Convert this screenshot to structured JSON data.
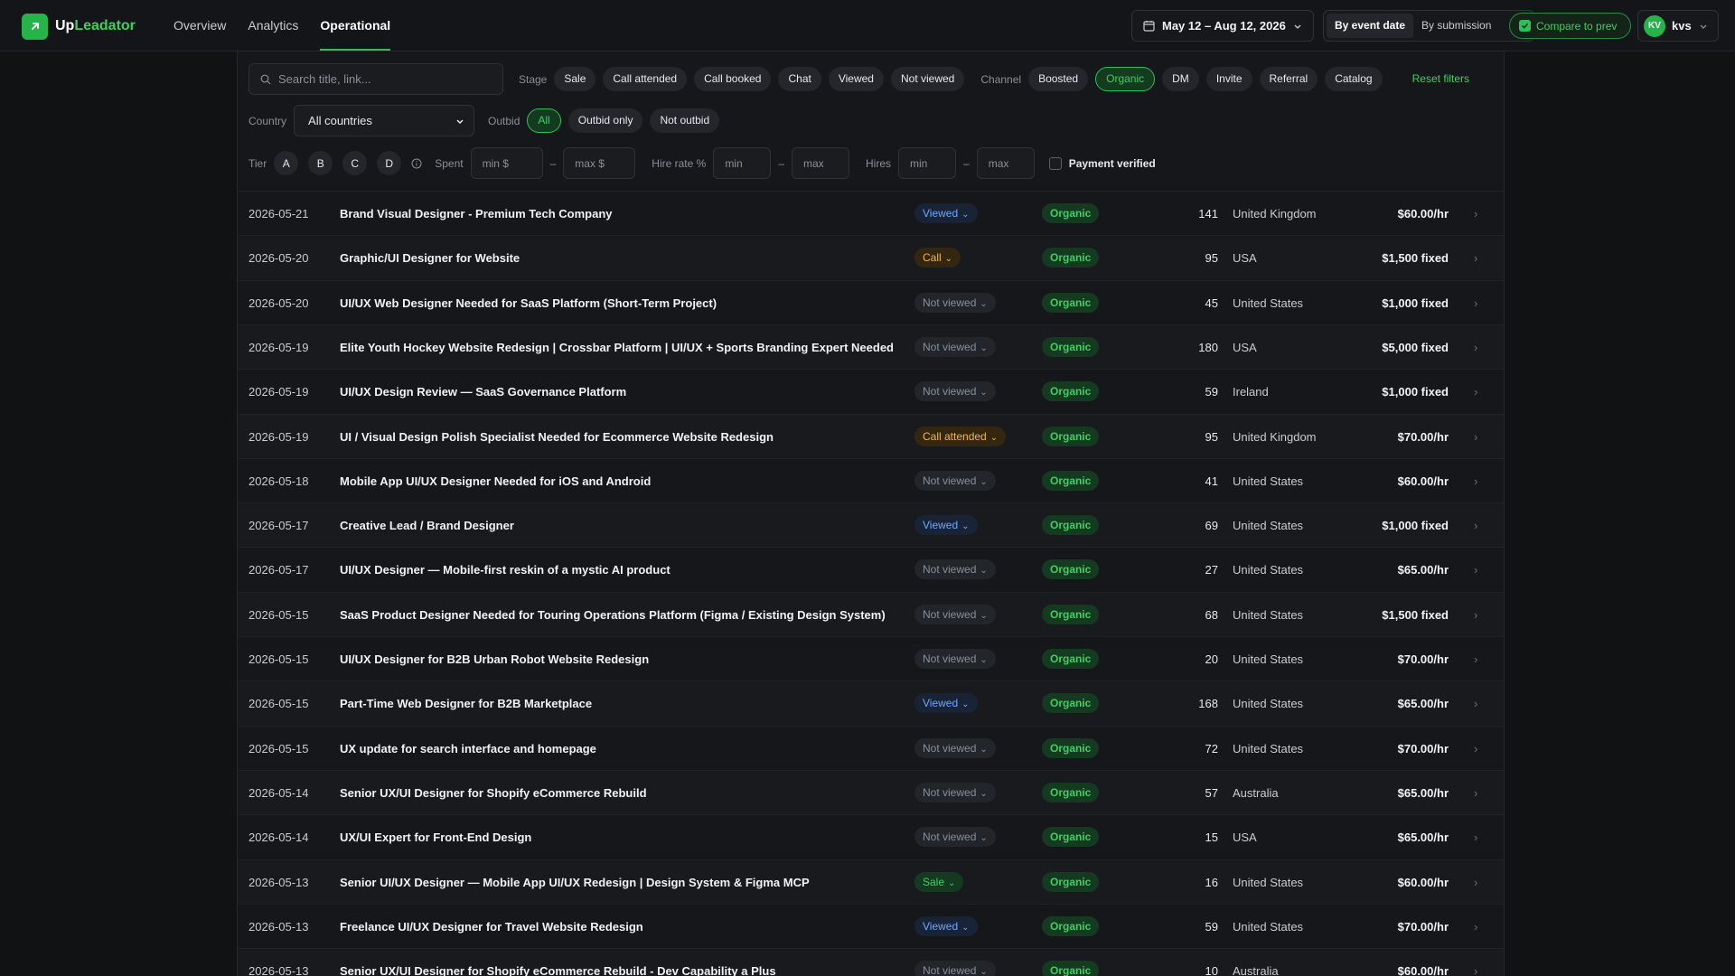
{
  "app": {
    "brand_up": "Up",
    "brand_rest": "Leadator"
  },
  "nav": [
    {
      "label": "Overview",
      "active": false
    },
    {
      "label": "Analytics",
      "active": false
    },
    {
      "label": "Operational",
      "active": true
    }
  ],
  "header": {
    "date_range": "May 12 – Aug 12, 2026",
    "by_event": "By event date",
    "by_submission": "By submission",
    "compare": "Compare to prev",
    "avatar_initials": "KV",
    "user_name": "kvs"
  },
  "filters": {
    "search_placeholder": "Search title, link...",
    "stage_label": "Stage",
    "stages": [
      "Sale",
      "Call attended",
      "Call booked",
      "Chat",
      "Viewed",
      "Not viewed"
    ],
    "channel_label": "Channel",
    "channels": [
      {
        "label": "Boosted",
        "active": false
      },
      {
        "label": "Organic",
        "active": true
      },
      {
        "label": "DM",
        "active": false
      },
      {
        "label": "Invite",
        "active": false
      },
      {
        "label": "Referral",
        "active": false
      },
      {
        "label": "Catalog",
        "active": false
      }
    ],
    "reset": "Reset filters",
    "country_label": "Country",
    "country_value": "All countries",
    "outbid_label": "Outbid",
    "outbid_options": [
      {
        "label": "All",
        "active": true
      },
      {
        "label": "Outbid only",
        "active": false
      },
      {
        "label": "Not outbid",
        "active": false
      }
    ],
    "tier_label": "Tier",
    "tiers": [
      "A",
      "B",
      "C",
      "D"
    ],
    "spent_label": "Spent",
    "spent_min": "min $",
    "spent_max": "max $",
    "hire_rate_label": "Hire rate %",
    "hire_min": "min",
    "hire_max": "max",
    "hires_label": "Hires",
    "hires_min": "min",
    "hires_max": "max",
    "payment_verified": "Payment verified",
    "range_dash": "–"
  },
  "rows": [
    {
      "date": "2026-05-21",
      "title": "Brand Visual Designer - Premium Tech Company",
      "stage": "Viewed",
      "stage_type": "viewed",
      "channel": "Organic",
      "count": "141",
      "country": "United Kingdom",
      "rate": "$60.00/hr"
    },
    {
      "date": "2026-05-20",
      "title": "Graphic/UI Designer for Website",
      "stage": "Call",
      "stage_type": "call",
      "channel": "Organic",
      "count": "95",
      "country": "USA",
      "rate": "$1,500 fixed"
    },
    {
      "date": "2026-05-20",
      "title": "UI/UX Web Designer Needed for SaaS Platform (Short-Term Project)",
      "stage": "Not viewed",
      "stage_type": "not",
      "channel": "Organic",
      "count": "45",
      "country": "United States",
      "rate": "$1,000 fixed"
    },
    {
      "date": "2026-05-19",
      "title": "Elite Youth Hockey Website Redesign | Crossbar Platform | UI/UX + Sports Branding Expert Needed",
      "stage": "Not viewed",
      "stage_type": "not",
      "channel": "Organic",
      "count": "180",
      "country": "USA",
      "rate": "$5,000 fixed"
    },
    {
      "date": "2026-05-19",
      "title": "UI/UX Design Review — SaaS Governance Platform",
      "stage": "Not viewed",
      "stage_type": "not",
      "channel": "Organic",
      "count": "59",
      "country": "Ireland",
      "rate": "$1,000 fixed"
    },
    {
      "date": "2026-05-19",
      "title": "UI / Visual Design Polish Specialist Needed for Ecommerce Website Redesign",
      "stage": "Call attended",
      "stage_type": "attended",
      "channel": "Organic",
      "count": "95",
      "country": "United Kingdom",
      "rate": "$70.00/hr"
    },
    {
      "date": "2026-05-18",
      "title": "Mobile App UI/UX Designer Needed for iOS and Android",
      "stage": "Not viewed",
      "stage_type": "not",
      "channel": "Organic",
      "count": "41",
      "country": "United States",
      "rate": "$60.00/hr"
    },
    {
      "date": "2026-05-17",
      "title": "Creative Lead / Brand Designer",
      "stage": "Viewed",
      "stage_type": "viewed",
      "channel": "Organic",
      "count": "69",
      "country": "United States",
      "rate": "$1,000 fixed"
    },
    {
      "date": "2026-05-17",
      "title": "UI/UX Designer — Mobile-first reskin of a mystic AI product",
      "stage": "Not viewed",
      "stage_type": "not",
      "channel": "Organic",
      "count": "27",
      "country": "United States",
      "rate": "$65.00/hr"
    },
    {
      "date": "2026-05-15",
      "title": "SaaS Product Designer Needed for Touring Operations Platform (Figma / Existing Design System)",
      "stage": "Not viewed",
      "stage_type": "not",
      "channel": "Organic",
      "count": "68",
      "country": "United States",
      "rate": "$1,500 fixed"
    },
    {
      "date": "2026-05-15",
      "title": "UI/UX Designer for B2B Urban Robot Website Redesign",
      "stage": "Not viewed",
      "stage_type": "not",
      "channel": "Organic",
      "count": "20",
      "country": "United States",
      "rate": "$70.00/hr"
    },
    {
      "date": "2026-05-15",
      "title": "Part-Time Web Designer for B2B Marketplace",
      "stage": "Viewed",
      "stage_type": "viewed",
      "channel": "Organic",
      "count": "168",
      "country": "United States",
      "rate": "$65.00/hr"
    },
    {
      "date": "2026-05-15",
      "title": "UX update for search interface and homepage",
      "stage": "Not viewed",
      "stage_type": "not",
      "channel": "Organic",
      "count": "72",
      "country": "United States",
      "rate": "$70.00/hr"
    },
    {
      "date": "2026-05-14",
      "title": "Senior UX/UI Designer for Shopify eCommerce Rebuild",
      "stage": "Not viewed",
      "stage_type": "not",
      "channel": "Organic",
      "count": "57",
      "country": "Australia",
      "rate": "$65.00/hr"
    },
    {
      "date": "2026-05-14",
      "title": "UX/UI Expert for Front-End Design",
      "stage": "Not viewed",
      "stage_type": "not",
      "channel": "Organic",
      "count": "15",
      "country": "USA",
      "rate": "$65.00/hr"
    },
    {
      "date": "2026-05-13",
      "title": "Senior UI/UX Designer — Mobile App UI/UX Redesign | Design System & Figma MCP",
      "stage": "Sale",
      "stage_type": "sale",
      "channel": "Organic",
      "count": "16",
      "country": "United States",
      "rate": "$60.00/hr"
    },
    {
      "date": "2026-05-13",
      "title": "Freelance UI/UX Designer for Travel Website Redesign",
      "stage": "Viewed",
      "stage_type": "viewed",
      "channel": "Organic",
      "count": "59",
      "country": "United States",
      "rate": "$70.00/hr"
    },
    {
      "date": "2026-05-13",
      "title": "Senior UX/UI Designer for Shopify eCommerce Rebuild - Dev Capability a Plus",
      "stage": "Not viewed",
      "stage_type": "not",
      "channel": "Organic",
      "count": "10",
      "country": "Australia",
      "rate": "$60.00/hr"
    }
  ]
}
